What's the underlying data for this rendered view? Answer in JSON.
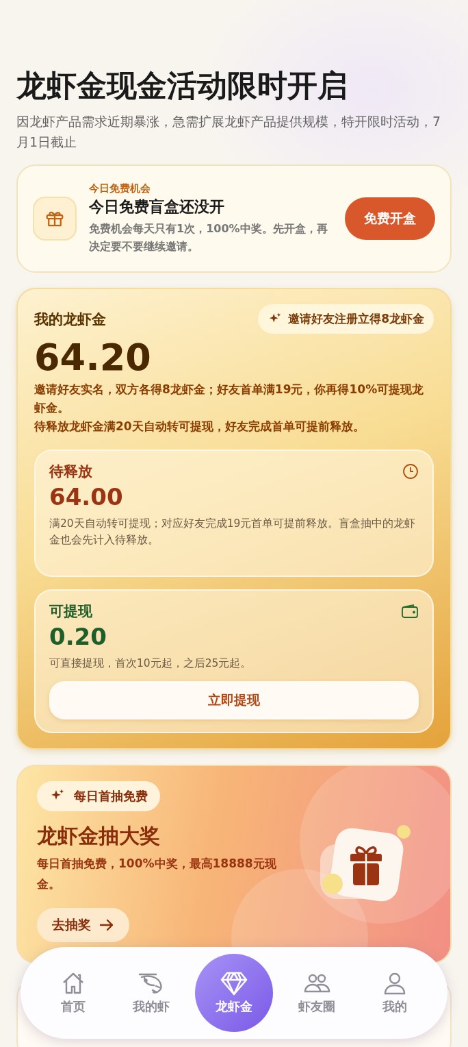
{
  "header": {
    "title": "龙虾金现金活动限时开启",
    "subtitle": "因龙虾产品需求近期暴涨，急需扩展龙虾产品提供规模，特开限时活动，7月1日截止"
  },
  "free_box": {
    "label": "今日免费机会",
    "title": "今日免费盲盒还没开",
    "description": "免费机会每天只有1次，100%中奖。先开盒，再决定要不要继续邀请。",
    "button": "免费开盒"
  },
  "balance": {
    "title": "我的龙虾金",
    "invite_pill": "邀请好友注册立得8龙虾金",
    "amount": "64.20",
    "rules": [
      "邀请好友实名，双方各得8龙虾金；好友首单满19元，你再得10%可提现龙虾金。",
      "待释放龙虾金满20天自动转可提现，好友完成首单可提前释放。"
    ],
    "parts": [
      {
        "kind": "pending",
        "label": "待释放",
        "amount": "64.00",
        "note": "满20天自动转可提现；对应好友完成19元首单可提前释放。盲盒抽中的龙虾金也会先计入待释放。"
      },
      {
        "kind": "withdrawable",
        "label": "可提现",
        "amount": "0.20",
        "note": "可直接提现，首次10元起，之后25元起。",
        "button": "立即提现"
      }
    ]
  },
  "lottery": {
    "badge": "每日首抽免费",
    "title": "龙虾金抽大奖",
    "description": "每日首抽免费，100%中奖，最高18888元现金。",
    "button": "去抽奖"
  },
  "tab_bar": [
    {
      "kind": "home",
      "label": "首页",
      "selected": false
    },
    {
      "kind": "shrimp",
      "label": "我的虾",
      "selected": false
    },
    {
      "kind": "diamond",
      "label": "龙虾金",
      "selected": true
    },
    {
      "kind": "friends",
      "label": "虾友圈",
      "selected": false
    },
    {
      "kind": "user",
      "label": "我的",
      "selected": false
    }
  ]
}
